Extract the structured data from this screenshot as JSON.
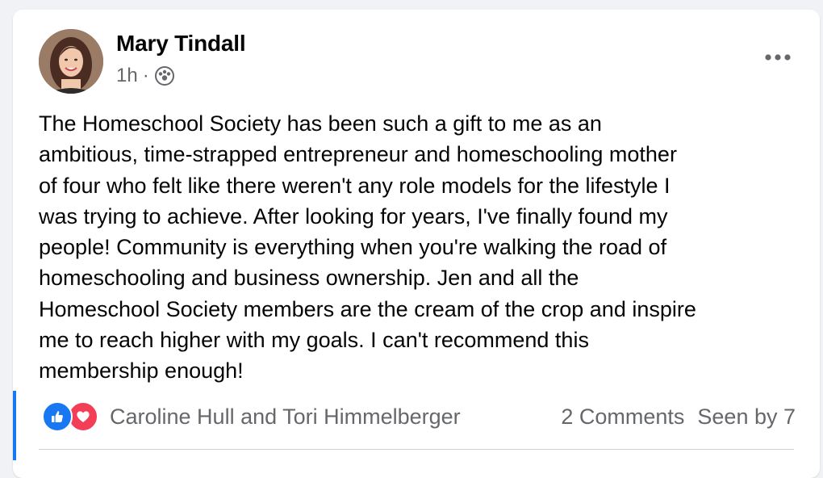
{
  "post": {
    "author": "Mary Tindall",
    "time": "1h",
    "separator": "·",
    "audience_icon": "group-icon",
    "more_icon": "more-horizontal-icon",
    "text": "The Homeschool Society has been such a gift to me as an\nambitious, time-strapped entrepreneur and homeschooling mother\nof four who felt like there weren't any role models for the lifestyle I\nwas trying to achieve. After looking for years, I've finally found my\npeople! Community is everything when you're walking the road of\nhomeschooling and business ownership. Jen and all the\nHomeschool Society members are the cream of the crop and inspire\nme to reach higher with my goals. I can't recommend this\nmembership enough!"
  },
  "footer": {
    "reaction_icons": [
      "like-icon",
      "love-icon"
    ],
    "reactors": "Caroline Hull and Tori Himmelberger",
    "comments": "2 Comments",
    "seen_by": "Seen by 7"
  },
  "colors": {
    "accent": "#1877f2",
    "like": "#1877f2",
    "love": "#f33e58",
    "secondary_text": "#65676b",
    "primary_text": "#050505"
  }
}
